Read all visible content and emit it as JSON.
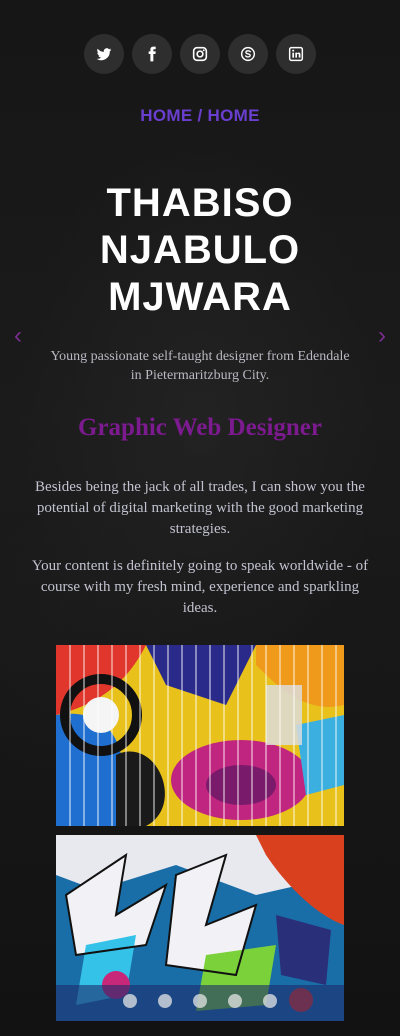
{
  "social": [
    {
      "name": "twitter-icon"
    },
    {
      "name": "facebook-icon"
    },
    {
      "name": "instagram-icon"
    },
    {
      "name": "skype-icon"
    },
    {
      "name": "linkedin-icon"
    }
  ],
  "breadcrumb": {
    "first": "HOME",
    "separator": "/",
    "second": "HOME"
  },
  "hero": {
    "line1": "THABISO",
    "line2": "NJABULO",
    "line3": "MJWARA",
    "prev": "‹",
    "next": "›"
  },
  "tagline": "Young passionate self-taught designer from Edendale in Pietermaritzburg City.",
  "role": "Graphic Web Designer",
  "paragraphs": {
    "p1": "Besides being the jack of all trades, I can show you the potential of digital marketing with the good marketing strategies.",
    "p2": "Your content is definitely going to speak worldwide - of course with my fresh mind, experience and sparkling ideas."
  },
  "colors": {
    "accent": "#6a3fcf",
    "role": "#7c1a8f",
    "background": "#141414"
  },
  "carousel": {
    "dot_count": 5
  }
}
